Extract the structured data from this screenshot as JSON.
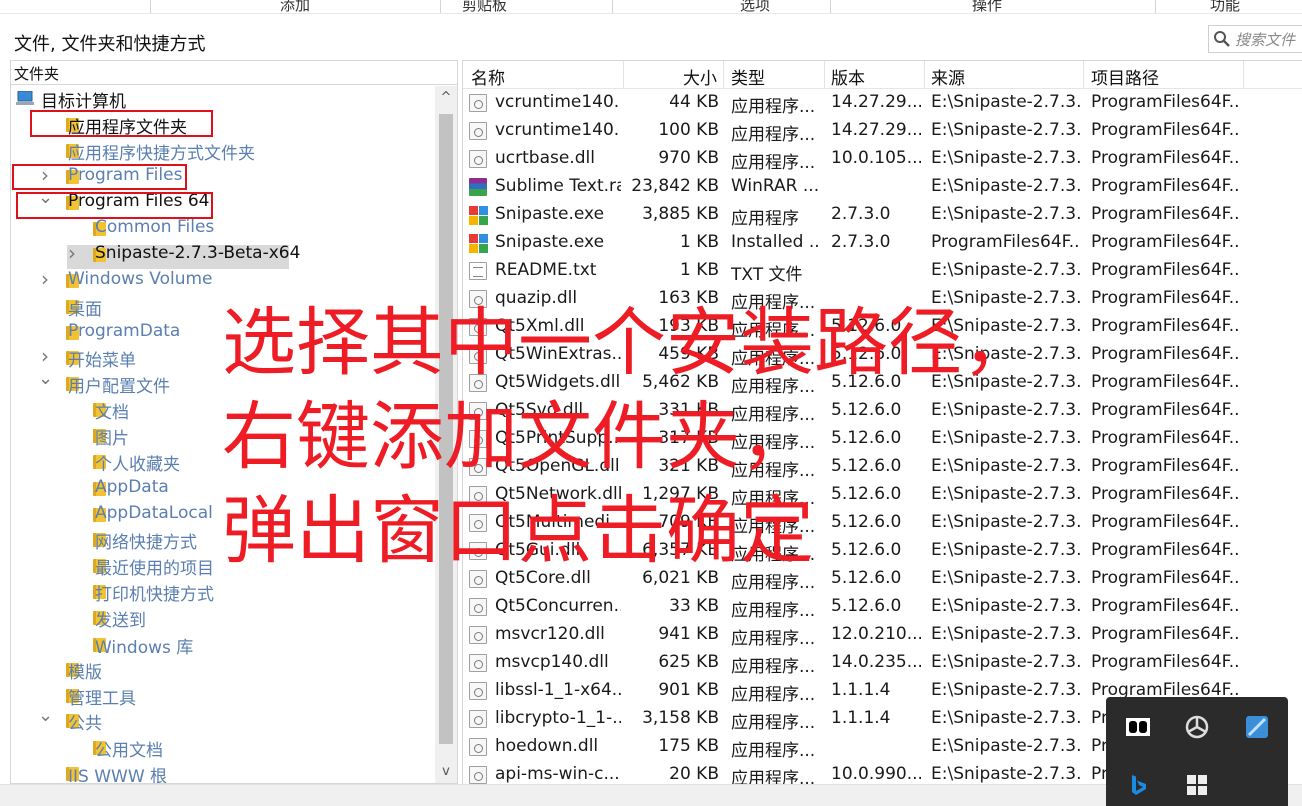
{
  "ribbon": {
    "groups": [
      "添加",
      "剪贴板",
      "选项",
      "操作",
      "功能"
    ]
  },
  "window": {
    "title": "文件, 文件夹和快捷方式",
    "search_placeholder": "搜索文件"
  },
  "tree": {
    "header": "文件夹",
    "nodes": [
      {
        "label": "目标计算机",
        "icon": "computer-icon",
        "arrow": ""
      },
      {
        "label": "应用程序文件夹",
        "icon": "folder-icon",
        "arrow": ""
      },
      {
        "label": "应用程序快捷方式文件夹",
        "icon": "folder-icon",
        "arrow": ""
      },
      {
        "label": "Program Files",
        "icon": "folder-icon",
        "arrow": ">"
      },
      {
        "label": "Program Files 64",
        "icon": "folder-icon",
        "arrow": "v"
      },
      {
        "label": "Common Files",
        "icon": "folder-icon",
        "arrow": ""
      },
      {
        "label": "Snipaste-2.7.3-Beta-x64",
        "icon": "folder-icon",
        "arrow": ">"
      },
      {
        "label": "Windows Volume",
        "icon": "folder-icon",
        "arrow": ">"
      },
      {
        "label": "桌面",
        "icon": "folder-icon",
        "arrow": ""
      },
      {
        "label": "ProgramData",
        "icon": "folder-icon",
        "arrow": ""
      },
      {
        "label": "开始菜单",
        "icon": "folder-icon",
        "arrow": ">"
      },
      {
        "label": "用户配置文件",
        "icon": "folder-icon",
        "arrow": "v"
      },
      {
        "label": "文档",
        "icon": "folder-icon",
        "arrow": ""
      },
      {
        "label": "图片",
        "icon": "folder-icon",
        "arrow": ""
      },
      {
        "label": "个人收藏夹",
        "icon": "folder-icon",
        "arrow": ""
      },
      {
        "label": "AppData",
        "icon": "folder-icon",
        "arrow": ""
      },
      {
        "label": "AppDataLocal",
        "icon": "folder-icon",
        "arrow": ""
      },
      {
        "label": "网络快捷方式",
        "icon": "folder-icon",
        "arrow": ""
      },
      {
        "label": "最近使用的项目",
        "icon": "folder-icon",
        "arrow": ""
      },
      {
        "label": "打印机快捷方式",
        "icon": "folder-icon",
        "arrow": ""
      },
      {
        "label": "发送到",
        "icon": "folder-icon",
        "arrow": ""
      },
      {
        "label": "Windows 库",
        "icon": "folder-icon",
        "arrow": ""
      },
      {
        "label": "模版",
        "icon": "folder-icon",
        "arrow": ""
      },
      {
        "label": "管理工具",
        "icon": "folder-icon",
        "arrow": ""
      },
      {
        "label": "公共",
        "icon": "folder-icon",
        "arrow": "v"
      },
      {
        "label": "公用文档",
        "icon": "folder-icon",
        "arrow": ""
      },
      {
        "label": "IIS WWW 根",
        "icon": "folder-icon",
        "arrow": ""
      }
    ],
    "scroll_up": "^",
    "scroll_down": "v"
  },
  "list": {
    "columns": [
      "名称",
      "大小",
      "类型",
      "版本",
      "来源",
      "项目路径"
    ],
    "rows": [
      {
        "icon": "dll",
        "name": "vcruntime140....",
        "size": "44 KB",
        "type": "应用程序...",
        "version": "14.27.29...",
        "source": "E:\\Snipaste-2.7.3...",
        "path": "ProgramFiles64F..."
      },
      {
        "icon": "dll",
        "name": "vcruntime140....",
        "size": "100 KB",
        "type": "应用程序...",
        "version": "14.27.29...",
        "source": "E:\\Snipaste-2.7.3...",
        "path": "ProgramFiles64F..."
      },
      {
        "icon": "dll",
        "name": "ucrtbase.dll",
        "size": "970 KB",
        "type": "应用程序...",
        "version": "10.0.105...",
        "source": "E:\\Snipaste-2.7.3...",
        "path": "ProgramFiles64F..."
      },
      {
        "icon": "rar",
        "name": "Sublime Text.rar",
        "size": "23,842 KB",
        "type": "WinRAR ...",
        "version": "",
        "source": "E:\\Snipaste-2.7.3...",
        "path": "ProgramFiles64F..."
      },
      {
        "icon": "exe",
        "name": "Snipaste.exe",
        "size": "3,885 KB",
        "type": "应用程序",
        "version": "2.7.3.0",
        "source": "E:\\Snipaste-2.7.3...",
        "path": "ProgramFiles64F..."
      },
      {
        "icon": "exe",
        "name": "Snipaste.exe",
        "size": "1 KB",
        "type": "Installed ...",
        "version": "2.7.3.0",
        "source": "ProgramFiles64F...",
        "path": "ProgramFiles64F..."
      },
      {
        "icon": "txt",
        "name": "README.txt",
        "size": "1 KB",
        "type": "TXT 文件",
        "version": "",
        "source": "E:\\Snipaste-2.7.3...",
        "path": "ProgramFiles64F..."
      },
      {
        "icon": "dll",
        "name": "quazip.dll",
        "size": "163 KB",
        "type": "应用程序...",
        "version": "",
        "source": "E:\\Snipaste-2.7.3...",
        "path": "ProgramFiles64F..."
      },
      {
        "icon": "dll",
        "name": "Qt5Xml.dll",
        "size": "193 KB",
        "type": "应用程序...",
        "version": "5.12.6.0",
        "source": "E:\\Snipaste-2.7.3...",
        "path": "ProgramFiles64F..."
      },
      {
        "icon": "dll",
        "name": "Qt5WinExtras....",
        "size": "459 KB",
        "type": "应用程序...",
        "version": "5.12.6.0",
        "source": "E:\\Snipaste-2.7.3...",
        "path": "ProgramFiles64F..."
      },
      {
        "icon": "dll",
        "name": "Qt5Widgets.dll",
        "size": "5,462 KB",
        "type": "应用程序...",
        "version": "5.12.6.0",
        "source": "E:\\Snipaste-2.7.3...",
        "path": "ProgramFiles64F..."
      },
      {
        "icon": "dll",
        "name": "Qt5Svg.dll",
        "size": "331 KB",
        "type": "应用程序...",
        "version": "5.12.6.0",
        "source": "E:\\Snipaste-2.7.3...",
        "path": "ProgramFiles64F..."
      },
      {
        "icon": "dll",
        "name": "Qt5PrintSupp...",
        "size": "317 KB",
        "type": "应用程序...",
        "version": "5.12.6.0",
        "source": "E:\\Snipaste-2.7.3...",
        "path": "ProgramFiles64F..."
      },
      {
        "icon": "dll",
        "name": "Qt5OpenGL.dll",
        "size": "321 KB",
        "type": "应用程序...",
        "version": "5.12.6.0",
        "source": "E:\\Snipaste-2.7.3...",
        "path": "ProgramFiles64F..."
      },
      {
        "icon": "dll",
        "name": "Qt5Network.dll",
        "size": "1,297 KB",
        "type": "应用程序...",
        "version": "5.12.6.0",
        "source": "E:\\Snipaste-2.7.3...",
        "path": "ProgramFiles64F..."
      },
      {
        "icon": "dll",
        "name": "Qt5Multimedi...",
        "size": "709 KB",
        "type": "应用程序...",
        "version": "5.12.6.0",
        "source": "E:\\Snipaste-2.7.3...",
        "path": "ProgramFiles64F..."
      },
      {
        "icon": "dll",
        "name": "Qt5Gui.dll",
        "size": "6,357 KB",
        "type": "应用程序...",
        "version": "5.12.6.0",
        "source": "E:\\Snipaste-2.7.3...",
        "path": "ProgramFiles64F..."
      },
      {
        "icon": "dll",
        "name": "Qt5Core.dll",
        "size": "6,021 KB",
        "type": "应用程序...",
        "version": "5.12.6.0",
        "source": "E:\\Snipaste-2.7.3...",
        "path": "ProgramFiles64F..."
      },
      {
        "icon": "dll",
        "name": "Qt5Concurren...",
        "size": "33 KB",
        "type": "应用程序...",
        "version": "5.12.6.0",
        "source": "E:\\Snipaste-2.7.3...",
        "path": "ProgramFiles64F..."
      },
      {
        "icon": "dll",
        "name": "msvcr120.dll",
        "size": "941 KB",
        "type": "应用程序...",
        "version": "12.0.210...",
        "source": "E:\\Snipaste-2.7.3...",
        "path": "ProgramFiles64F..."
      },
      {
        "icon": "dll",
        "name": "msvcp140.dll",
        "size": "625 KB",
        "type": "应用程序...",
        "version": "14.0.235...",
        "source": "E:\\Snipaste-2.7.3...",
        "path": "ProgramFiles64F..."
      },
      {
        "icon": "dll",
        "name": "libssl-1_1-x64....",
        "size": "901 KB",
        "type": "应用程序...",
        "version": "1.1.1.4",
        "source": "E:\\Snipaste-2.7.3...",
        "path": "ProgramFiles64F..."
      },
      {
        "icon": "dll",
        "name": "libcrypto-1_1-...",
        "size": "3,158 KB",
        "type": "应用程序...",
        "version": "1.1.1.4",
        "source": "E:\\Snipaste-2.7.3...",
        "path": "Pr"
      },
      {
        "icon": "dll",
        "name": "hoedown.dll",
        "size": "175 KB",
        "type": "应用程序...",
        "version": "",
        "source": "E:\\Snipaste-2.7.3...",
        "path": "Pr"
      },
      {
        "icon": "dll",
        "name": "api-ms-win-c...",
        "size": "20 KB",
        "type": "应用程序...",
        "version": "10.0.990...",
        "source": "E:\\Snipaste-2.7.3...",
        "path": "Pr"
      }
    ]
  },
  "overlay": {
    "lines": [
      "选择其中一个安装路径，",
      "右键添加文件夹，",
      "弹出窗口点击确定"
    ],
    "color": "#ee1c24"
  },
  "tray": {
    "icons": [
      "dolby-icon",
      "hub-icon",
      "paint-icon",
      "bing-icon",
      "app-grid-icon"
    ]
  },
  "colors": {
    "annotation_red": "#e0101a",
    "tree_text": "#5a7fb0",
    "folder": "#f2c233"
  }
}
